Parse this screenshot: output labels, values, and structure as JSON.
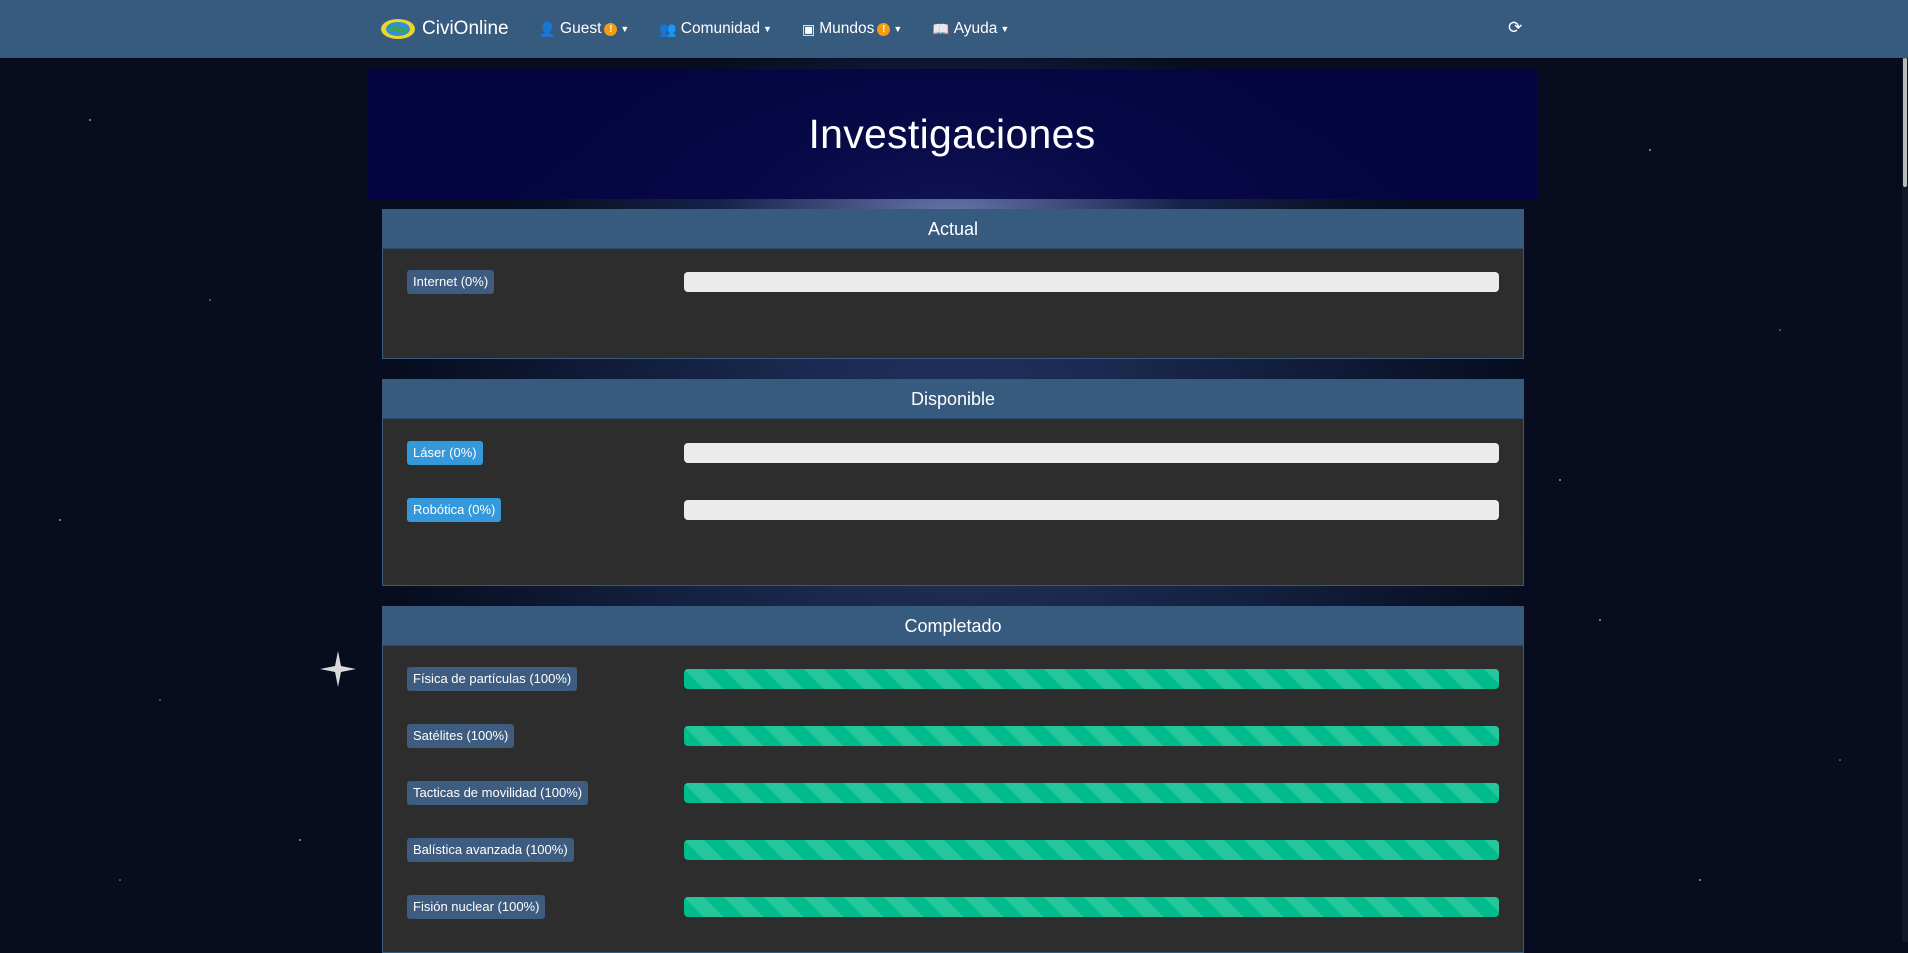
{
  "nav": {
    "brand": "CiviOnline",
    "items": [
      {
        "label": "Guest",
        "icon": "user-icon",
        "warning": true,
        "warning_glyph": "!"
      },
      {
        "label": "Comunidad",
        "icon": "users-icon",
        "warning": false
      },
      {
        "label": "Mundos",
        "icon": "map-icon",
        "warning": true,
        "warning_glyph": "!"
      },
      {
        "label": "Ayuda",
        "icon": "book-icon",
        "warning": false
      }
    ]
  },
  "page": {
    "title": "Investigaciones"
  },
  "panels": {
    "actual": {
      "heading": "Actual",
      "items": [
        {
          "label": "Internet (0%)",
          "progress": 0
        }
      ]
    },
    "disponible": {
      "heading": "Disponible",
      "items": [
        {
          "label": "Láser (0%)",
          "progress": 0
        },
        {
          "label": "Robótica (0%)",
          "progress": 0
        }
      ]
    },
    "completado": {
      "heading": "Completado",
      "items": [
        {
          "label": "Física de partículas (100%)",
          "progress": 100
        },
        {
          "label": "Satélites (100%)",
          "progress": 100
        },
        {
          "label": "Tacticas de movilidad (100%)",
          "progress": 100
        },
        {
          "label": "Balística avanzada (100%)",
          "progress": 100
        },
        {
          "label": "Fisión nuclear (100%)",
          "progress": 100
        }
      ]
    }
  },
  "colors": {
    "navbar": "#375a7f",
    "panel_bg": "#2d2d2d",
    "label_default": "#3d5c80",
    "label_available": "#3498db",
    "progress_success": "#00bc8c",
    "warning": "#f39c12"
  }
}
